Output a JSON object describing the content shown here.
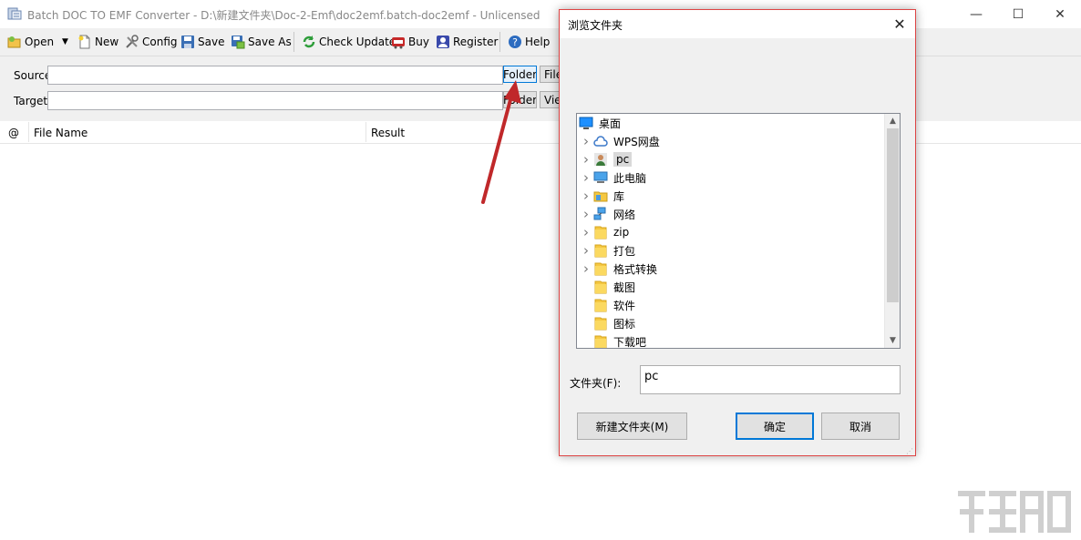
{
  "window": {
    "title": "Batch DOC TO EMF Converter - D:\\新建文件夹\\Doc-2-Emf\\doc2emf.batch-doc2emf - Unlicensed",
    "minimize": "—",
    "maximize": "☐",
    "close": "✕"
  },
  "toolbar": {
    "open": "Open",
    "new": "New",
    "config": "Config",
    "save": "Save",
    "save_as": "Save As",
    "check_update": "Check Update",
    "buy": "Buy",
    "register": "Register",
    "help": "Help"
  },
  "panel": {
    "source_label": "Source",
    "target_label": "Target",
    "source_folder_btn": "Folder",
    "source_file_btn": "File",
    "target_folder_btn": "Folder",
    "target_view_btn": "View"
  },
  "list": {
    "columns": [
      "@",
      "File Name",
      "Result"
    ]
  },
  "dialog": {
    "title": "浏览文件夹",
    "close": "✕",
    "tree": [
      {
        "label": "桌面",
        "icon": "desktop-icon",
        "expandable": false,
        "level": 0
      },
      {
        "label": "WPS网盘",
        "icon": "cloud-icon",
        "expandable": true,
        "level": 1
      },
      {
        "label": "pc",
        "icon": "user-icon",
        "expandable": true,
        "level": 1,
        "selected": true
      },
      {
        "label": "此电脑",
        "icon": "computer-icon",
        "expandable": true,
        "level": 1
      },
      {
        "label": "库",
        "icon": "library-icon",
        "expandable": true,
        "level": 1
      },
      {
        "label": "网络",
        "icon": "network-icon",
        "expandable": true,
        "level": 1
      },
      {
        "label": "zip",
        "icon": "folder-icon",
        "expandable": true,
        "level": 1
      },
      {
        "label": "打包",
        "icon": "folder-icon",
        "expandable": true,
        "level": 1
      },
      {
        "label": "格式转换",
        "icon": "folder-icon",
        "expandable": true,
        "level": 1
      },
      {
        "label": "截图",
        "icon": "folder-icon",
        "expandable": false,
        "level": 1
      },
      {
        "label": "软件",
        "icon": "folder-icon",
        "expandable": false,
        "level": 1
      },
      {
        "label": "图标",
        "icon": "folder-icon",
        "expandable": false,
        "level": 1
      },
      {
        "label": "下载吧",
        "icon": "folder-icon",
        "expandable": false,
        "level": 1
      }
    ],
    "folder_label": "文件夹(F):",
    "folder_value": "pc",
    "new_folder_btn": "新建文件夹(M)",
    "ok_btn": "确定",
    "cancel_btn": "取消"
  },
  "colors": {
    "accent": "#0078d7",
    "dialog_border": "#dd4444",
    "arrow": "#c0282a",
    "folder": "#f5c842"
  }
}
